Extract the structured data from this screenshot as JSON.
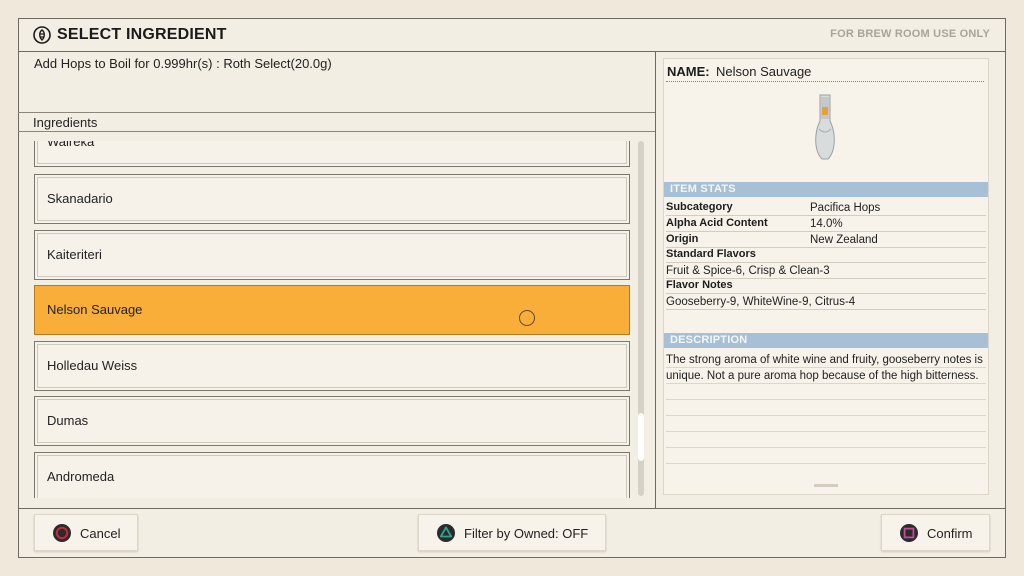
{
  "header": {
    "title": "SELECT INGREDIENT",
    "note": "FOR BREW ROOM USE ONLY",
    "icon": "hop-cone-icon"
  },
  "instruction": "Add  Hops  to Boil for  0.999hr(s) : Roth Select(20.0g)",
  "ingredients_header": "Ingredients",
  "ingredients": [
    {
      "name": "Waireka",
      "selected": false
    },
    {
      "name": "Skanadario",
      "selected": false
    },
    {
      "name": "Kaiteriteri",
      "selected": false
    },
    {
      "name": "Nelson Sauvage",
      "selected": true
    },
    {
      "name": "Holledau Weiss",
      "selected": false
    },
    {
      "name": "Dumas",
      "selected": false
    },
    {
      "name": "Andromeda",
      "selected": false
    }
  ],
  "details": {
    "name_label": "NAME:",
    "name_value": "Nelson Sauvage",
    "item_stats_title": "ITEM STATS",
    "subcategory_label": "Subcategory",
    "subcategory_value": "Pacifica Hops",
    "alpha_label": "Alpha Acid Content",
    "alpha_value": "14.0%",
    "origin_label": "Origin",
    "origin_value": "New Zealand",
    "standard_flavors_label": "Standard Flavors",
    "standard_flavors_value": "Fruit & Spice-6, Crisp & Clean-3",
    "flavor_notes_label": "Flavor Notes",
    "flavor_notes_value": "Gooseberry-9, WhiteWine-9, Citrus-4",
    "description_title": "DESCRIPTION",
    "description": "The strong aroma of white wine and fruity, gooseberry notes is unique. Not a pure aroma hop because of the high bitterness."
  },
  "buttons": {
    "cancel": "Cancel",
    "filter": "Filter by Owned: OFF",
    "confirm": "Confirm"
  },
  "colors": {
    "selected_row": "#f8ae38",
    "section_bar": "#a7c0d6",
    "circle_button": "#c8283c",
    "triangle_button": "#2aa58e",
    "square_button": "#c34b9a"
  }
}
